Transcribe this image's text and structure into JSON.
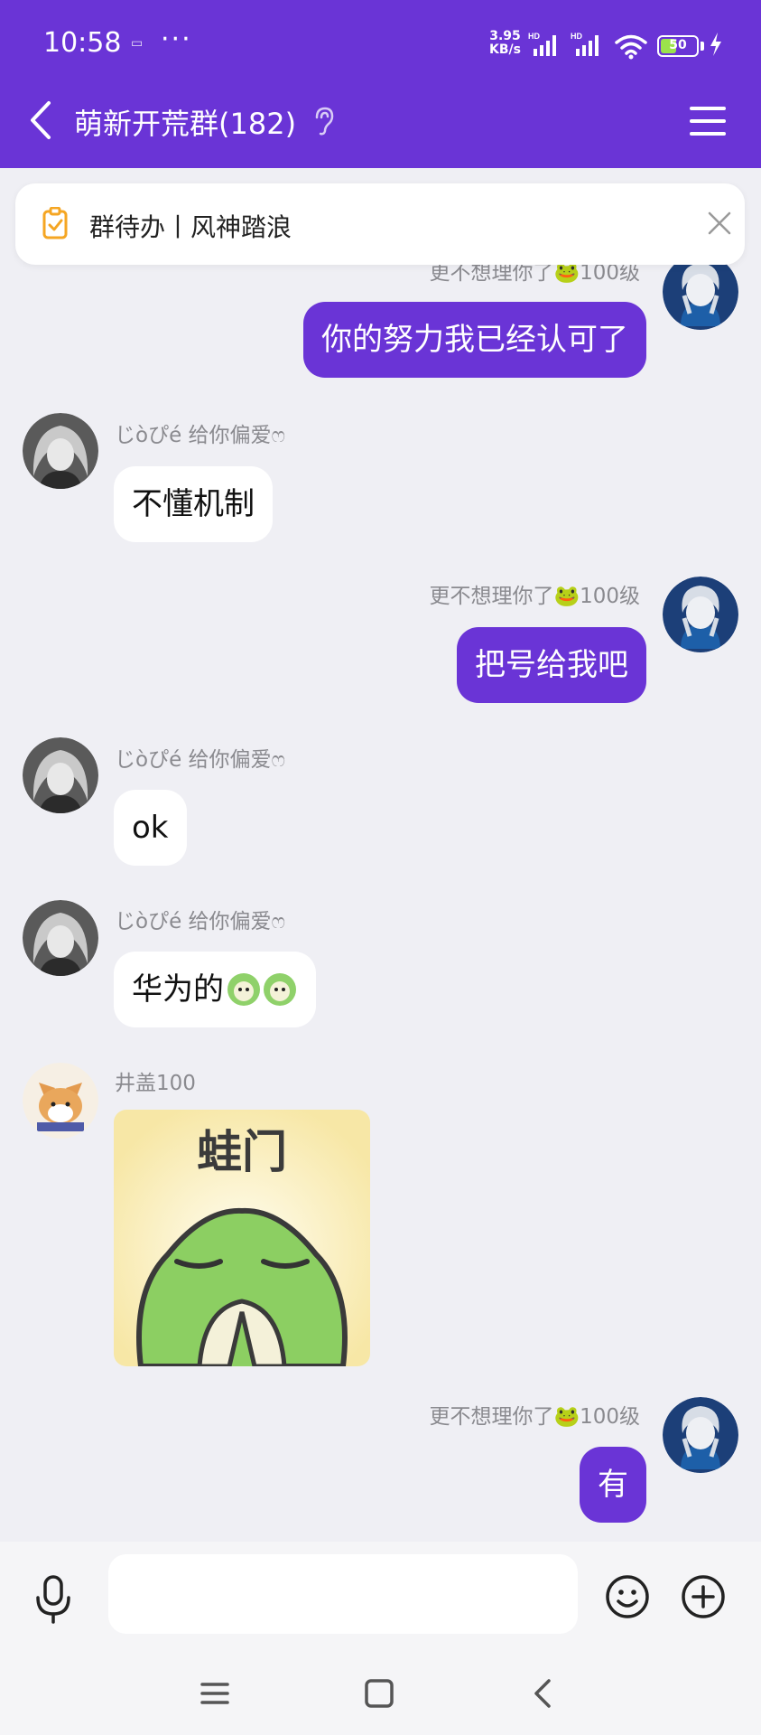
{
  "status_bar": {
    "time": "10:58",
    "small_icon": "▭",
    "dots": "···",
    "net_speed_value": "3.95",
    "net_speed_unit": "KB/s",
    "hd_label_1": "HD",
    "hd_label_2": "HD",
    "battery_level": 50,
    "battery_text": "50"
  },
  "header": {
    "title": "萌新开荒群(182)",
    "back_icon": "chevron-left-icon",
    "ear_icon": "ear-icon",
    "menu_icon": "hamburger-menu-icon"
  },
  "todo_bar": {
    "text": "群待办丨风神踏浪"
  },
  "messages": [
    {
      "side": "right",
      "sender": "更不想理你了🐸100级",
      "text": "你的努力我已经认可了"
    },
    {
      "side": "left",
      "sender": "じòぴé 给你偏爱ෆ",
      "text": "不懂机制"
    },
    {
      "side": "right",
      "sender": "更不想理你了🐸100级",
      "text": "把号给我吧"
    },
    {
      "side": "left",
      "sender": "じòぴé 给你偏爱ෆ",
      "text": "ok"
    },
    {
      "side": "left",
      "sender": "じòぴé 给你偏爱ෆ",
      "text": "华为的"
    },
    {
      "side": "left",
      "sender": "井盖100",
      "sticker_text": "蛙门"
    },
    {
      "side": "right",
      "sender": "更不想理你了🐸100级",
      "text": "有"
    }
  ],
  "input_bar": {
    "placeholder": "",
    "mic_icon": "microphone-icon",
    "emoji_icon": "smiley-icon",
    "plus_icon": "plus-circle-icon"
  },
  "colors": {
    "accent": "#6a34d6",
    "background": "#efeff4"
  }
}
